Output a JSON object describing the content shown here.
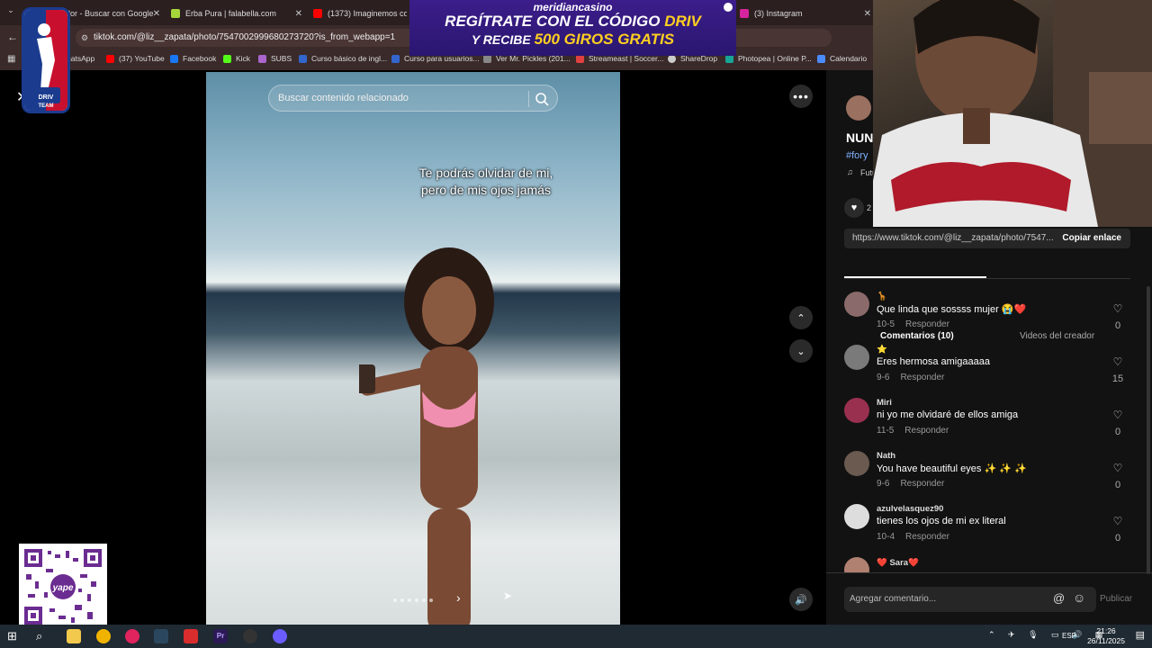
{
  "tabs": [
    {
      "label": "lor - Buscar con Google",
      "color": "#4285f4"
    },
    {
      "label": "Erba Pura | falabella.com",
      "color": "#a5d63a"
    },
    {
      "label": "(1373) Imaginemos cosa",
      "color": "#ff0000"
    },
    {
      "label": "(3) Instagram",
      "color": "#d6249f"
    }
  ],
  "address": {
    "url": "tiktok.com/@liz__zapata/photo/7547002999680273720?is_from_webapp=1"
  },
  "bookmarks": [
    {
      "label": "hatsApp",
      "color": "#25d366"
    },
    {
      "label": "(37) YouTube",
      "color": "#ff0000"
    },
    {
      "label": "Facebook",
      "color": "#1877f2"
    },
    {
      "label": "Kick",
      "color": "#53fc18"
    },
    {
      "label": "SUBS",
      "color": "#aa66cc"
    },
    {
      "label": "Curso básico de ingl...",
      "color": "#3366cc"
    },
    {
      "label": "Curso para usuarios...",
      "color": "#3366cc"
    },
    {
      "label": "Ver Mr. Pickles (201...",
      "color": "#888888"
    },
    {
      "label": "Streameast | Soccer...",
      "color": "#e04040"
    },
    {
      "label": "ShareDrop",
      "color": "#cccccc"
    },
    {
      "label": "Photopea | Online P...",
      "color": "#18a497"
    },
    {
      "label": "Calendario",
      "color": "#4a8cff"
    }
  ],
  "search": {
    "placeholder": "Buscar contenido relacionado"
  },
  "caption": {
    "line1": "Te podrás olvidar de mi,",
    "line2": "pero de mis ojos jamás"
  },
  "panel": {
    "title_partial": "NUN",
    "hashtag_partial": "#fory",
    "music_partial": "Futu",
    "likes_partial": "2",
    "link": "https://www.tiktok.com/@liz__zapata/photo/7547...",
    "copy_label": "Copiar enlace",
    "tab_comments": "Comentarios (10)",
    "tab_videos": "Videos del creador",
    "add_comment_placeholder": "Agregar comentario...",
    "publish_label": "Publicar"
  },
  "comments": [
    {
      "name": "🦒",
      "text": "Que linda que sossss mujer 😭❤️",
      "date": "10-5",
      "reply": "Responder",
      "likes": "0",
      "avatar_color": "#8a6a6a"
    },
    {
      "name": "⭐",
      "text": "Eres hermosa amigaaaaa",
      "date": "9-6",
      "reply": "Responder",
      "likes": "15",
      "avatar_color": "#7a7a7a"
    },
    {
      "name": "Miri",
      "text": "ni yo me olvidaré de ellos amiga",
      "date": "11-5",
      "reply": "Responder",
      "likes": "0",
      "avatar_color": "#9a3050"
    },
    {
      "name": "Nath",
      "text": "You have beautiful eyes ✨ ✨ ✨",
      "date": "9-6",
      "reply": "Responder",
      "likes": "0",
      "avatar_color": "#6a5a50"
    },
    {
      "name": "azulvelasquez90",
      "text": "tienes los ojos de mi ex literal",
      "date": "10-4",
      "reply": "Responder",
      "likes": "0",
      "avatar_color": "#dddddd"
    },
    {
      "name": "❤️ Sara❤️",
      "text": "",
      "date": "",
      "reply": "",
      "likes": "",
      "avatar_color": "#b08070"
    }
  ],
  "ad": {
    "brand": "meridiancasino",
    "line1_a": "REGÍTRATE CON EL CÓDIGO",
    "line1_b": "DRIV",
    "line2_a": "Y RECIBE",
    "line2_b": "500 GIROS GRATIS"
  },
  "logo": {
    "text": "DRIV TEAM"
  },
  "qr": {
    "label": "yape"
  },
  "taskbar": {
    "lang": "ESP",
    "time": "21:26",
    "date": "26/11/2025"
  },
  "colors": {
    "page_bg": "#000000",
    "panel_bg": "#121212",
    "accent_red": "#fe2c55"
  }
}
